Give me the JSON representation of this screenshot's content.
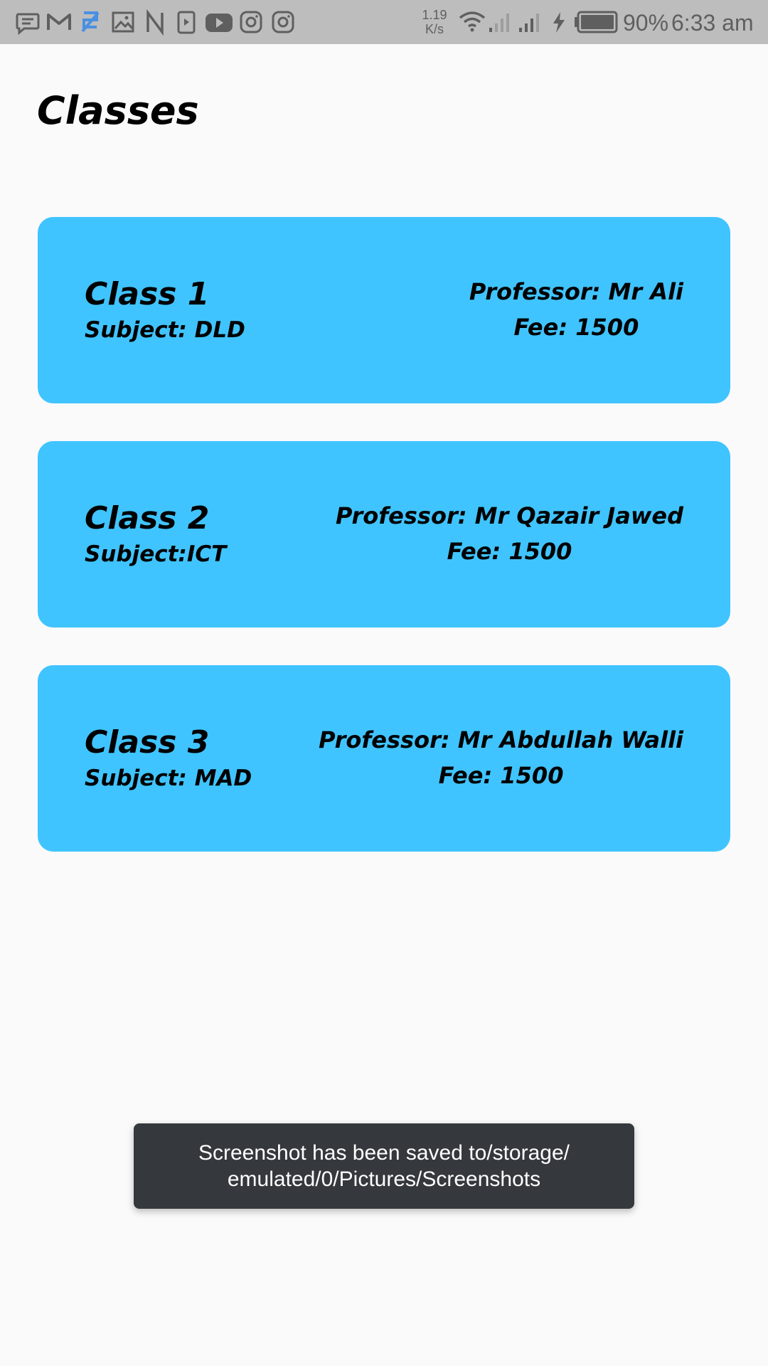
{
  "status_bar": {
    "notification_icons": [
      "message-icon",
      "gmail-icon",
      "ar-app-icon",
      "gallery-icon",
      "notion-icon",
      "media-player-icon",
      "youtube-icon",
      "instagram-icon",
      "instagram-icon"
    ],
    "net_speed_value": "1.19",
    "net_speed_unit": "K/s",
    "battery": "90%",
    "time": "6:33 am"
  },
  "page": {
    "title": "Classes",
    "background": "#fafafa"
  },
  "classes": [
    {
      "name": "Class 1",
      "subject": "Subject: DLD",
      "professor": "Professor: Mr Ali",
      "fee": "Fee: 1500"
    },
    {
      "name": "Class 2",
      "subject": "Subject:ICT",
      "professor": "Professor: Mr Qazair Jawed",
      "fee": "Fee: 1500"
    },
    {
      "name": "Class 3",
      "subject": "Subject: MAD",
      "professor": "Professor: Mr Abdullah Walli",
      "fee": "Fee: 1500"
    }
  ],
  "card_color": "#40c4ff",
  "toast": {
    "line1": "Screenshot has been saved to/storage/",
    "line2": "emulated/0/Pictures/Screenshots"
  }
}
